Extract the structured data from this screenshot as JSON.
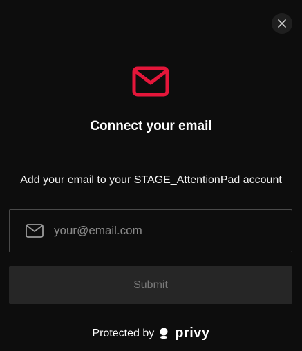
{
  "modal": {
    "close_icon": "close-icon",
    "hero_icon": "mail-icon",
    "title": "Connect your email",
    "subtitle": "Add your email to your STAGE_AttentionPad account"
  },
  "email_field": {
    "icon": "mail-icon",
    "placeholder": "your@email.com",
    "value": ""
  },
  "submit": {
    "label": "Submit",
    "enabled": false
  },
  "footer": {
    "protected_by": "Protected by",
    "brand": "privy"
  },
  "colors": {
    "accent": "#e4163a",
    "background": "#0d0d0d",
    "button_disabled_bg": "#262626",
    "button_disabled_text": "#7a7a7a"
  }
}
